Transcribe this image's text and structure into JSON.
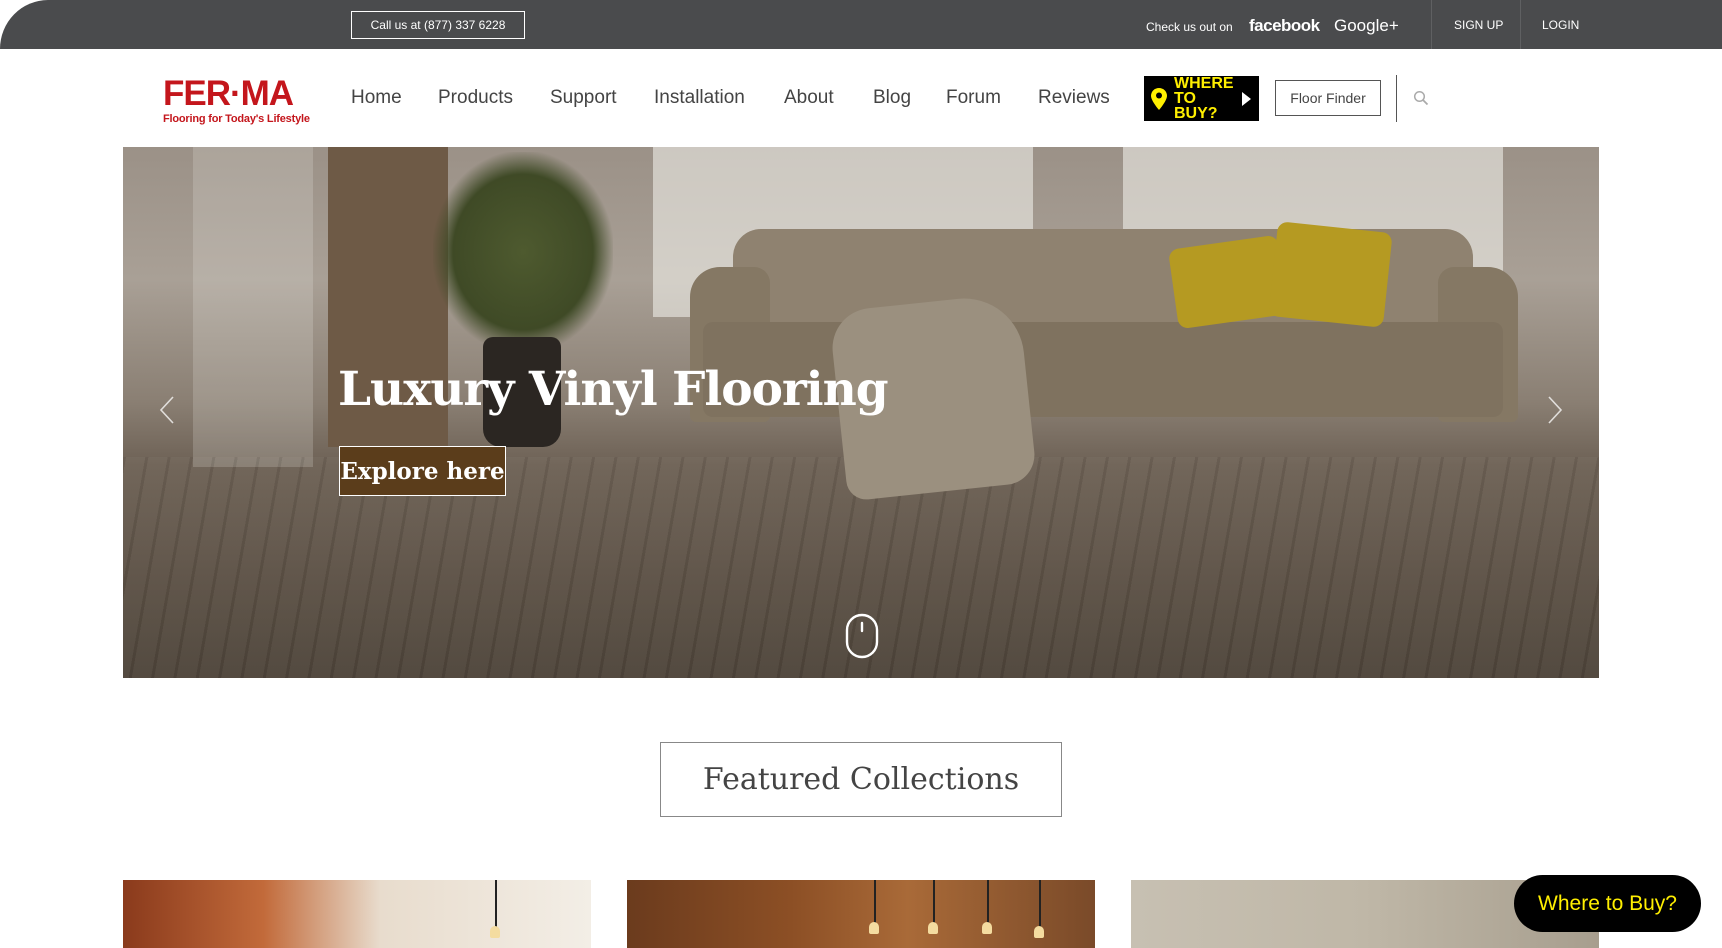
{
  "topbar": {
    "call_label": "Call us at (877) 337 6228",
    "check_label": "Check us out on",
    "facebook_label": "facebook",
    "google_label": "Google+",
    "signup_label": "SIGN UP",
    "login_label": "LOGIN"
  },
  "brand": {
    "name": "FER·MA",
    "tagline": "Flooring for Today's Lifestyle",
    "color": "#c4161c"
  },
  "nav": {
    "items": [
      "Home",
      "Products",
      "Support",
      "Installation",
      "About",
      "Blog",
      "Forum",
      "Reviews"
    ],
    "where_to_buy": "WHERE TO BUY?",
    "floor_finder": "Floor Finder",
    "search_icon": "search-icon"
  },
  "hero": {
    "title": "Luxury Vinyl Flooring",
    "button_label": "Explore here",
    "button_color": "#5b3d1b",
    "prev_icon": "chevron-left-icon",
    "next_icon": "chevron-right-icon",
    "scroll_icon": "mouse-scroll-icon"
  },
  "featured": {
    "title": "Featured Collections"
  },
  "floating": {
    "where_to_buy": "Where to Buy?",
    "accent": "#ffef00"
  }
}
